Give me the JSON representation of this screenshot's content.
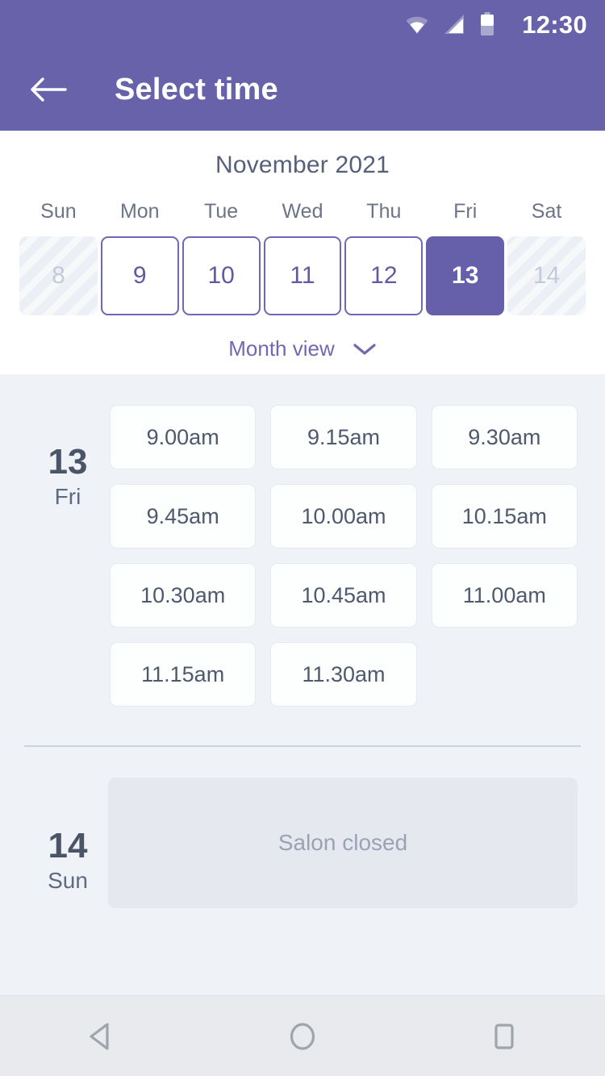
{
  "status_bar": {
    "time": "12:30",
    "icons": [
      "wifi-icon",
      "signal-icon",
      "battery-icon"
    ]
  },
  "app_bar": {
    "back_icon": "arrow-left-icon",
    "title": "Select time"
  },
  "calendar": {
    "month_title": "November 2021",
    "weekdays": [
      "Sun",
      "Mon",
      "Tue",
      "Wed",
      "Thu",
      "Fri",
      "Sat"
    ],
    "days": [
      {
        "num": "8",
        "state": "disabled"
      },
      {
        "num": "9",
        "state": "available"
      },
      {
        "num": "10",
        "state": "available"
      },
      {
        "num": "11",
        "state": "available"
      },
      {
        "num": "12",
        "state": "available"
      },
      {
        "num": "13",
        "state": "selected"
      },
      {
        "num": "14",
        "state": "disabled"
      }
    ],
    "month_view_label": "Month view",
    "month_view_icon": "chevron-down-icon"
  },
  "schedule": [
    {
      "day_number": "13",
      "day_of_week": "Fri",
      "slots": [
        "9.00am",
        "9.15am",
        "9.30am",
        "9.45am",
        "10.00am",
        "10.15am",
        "10.30am",
        "10.45am",
        "11.00am",
        "11.15am",
        "11.30am"
      ]
    },
    {
      "day_number": "14",
      "day_of_week": "Sun",
      "closed_message": "Salon closed"
    }
  ],
  "nav_bar": {
    "back_icon": "triangle-back-icon",
    "home_icon": "circle-home-icon",
    "recents_icon": "square-recents-icon"
  },
  "colors": {
    "brand_purple": "#6762a9",
    "selected_day": "#6660ab",
    "page_background": "#eff2f7",
    "card_background": "#fdfefe",
    "text_dark": "#4f596e",
    "text_muted": "#9aa2b3"
  }
}
